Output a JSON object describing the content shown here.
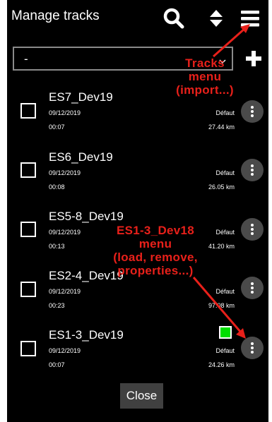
{
  "header": {
    "title": "Manage tracks",
    "icons": [
      "search-icon",
      "sort-icon",
      "menu-icon"
    ]
  },
  "filter": {
    "value": "-",
    "add_icon": "plus-icon"
  },
  "tracks": [
    {
      "name": "ES7_Dev19",
      "date": "09/12/2019",
      "duration": "00:07",
      "category": "Défaut",
      "distance": "27.44 km",
      "checked": false
    },
    {
      "name": "ES6_Dev19",
      "date": "09/12/2019",
      "duration": "00:08",
      "category": "Défaut",
      "distance": "26.05 km",
      "checked": false
    },
    {
      "name": "ES5-8_Dev19",
      "date": "09/12/2019",
      "duration": "00:13",
      "category": "Défaut",
      "distance": "41.20 km",
      "checked": false
    },
    {
      "name": "ES2-4_Dev19",
      "date": "09/12/2019",
      "duration": "00:23",
      "category": "Défaut",
      "distance": "97.08 km",
      "checked": false
    },
    {
      "name": "ES1-3_Dev19",
      "date": "09/12/2019",
      "duration": "00:07",
      "category": "Défaut",
      "distance": "24.26 km",
      "checked": false,
      "color": "#00dd00"
    }
  ],
  "close_label": "Close",
  "annotations": {
    "tracks_menu": [
      "Tracks",
      "menu",
      "(import...)"
    ],
    "track_menu": [
      "ES1-3_Dev18",
      "menu",
      "(load, remove,",
      "properties...)"
    ]
  },
  "colors": {
    "background": "#000000",
    "annotation": "#e8201a",
    "button": "#404040",
    "more_button": "#4a4a4a",
    "track_color": "#00dd00"
  }
}
